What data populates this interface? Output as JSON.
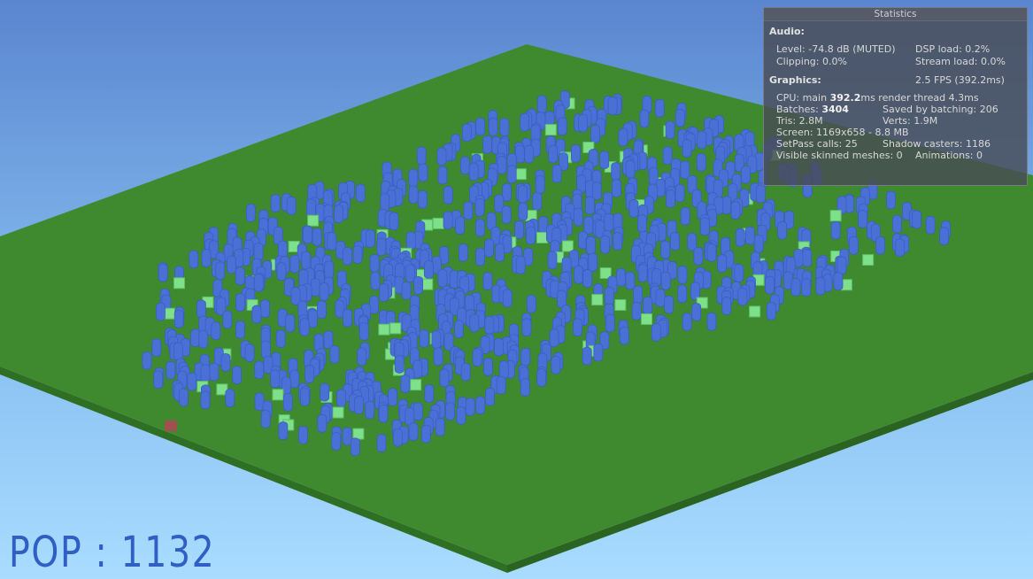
{
  "colors": {
    "sky_top": "#5a85cf",
    "sky_bottom": "#a9dcff",
    "ground_top": "#3f8a2f",
    "ground_side": "#2f6f24",
    "agent": "#4a70d6",
    "food": "#7fe08a",
    "marker": "#a0504f",
    "pop_text": "#2f5fc4"
  },
  "hud": {
    "population_label": "POP : 1132"
  },
  "statistics": {
    "title": "Statistics",
    "audio": {
      "header": "Audio:",
      "level": "Level: -74.8 dB (MUTED)",
      "dsp": "DSP load: 0.2%",
      "clipping": "Clipping: 0.0%",
      "stream": "Stream load: 0.0%"
    },
    "graphics": {
      "header": "Graphics:",
      "fps": "2.5 FPS (392.2ms)",
      "cpu_prefix": "CPU: main ",
      "cpu_main": "392.2",
      "cpu_suffix": "ms  render thread 4.3ms",
      "batches_prefix": "Batches: ",
      "batches": "3404",
      "saved": "Saved by batching: 206",
      "tris": "Tris: 2.8M",
      "verts": "Verts: 1.9M",
      "screen": "Screen: 1169x658 - 8.8 MB",
      "setpass": "SetPass calls: 25",
      "shadow": "Shadow casters: 1186",
      "skinned": "Visible skinned meshes: 0",
      "animations": "Animations: 0"
    }
  }
}
